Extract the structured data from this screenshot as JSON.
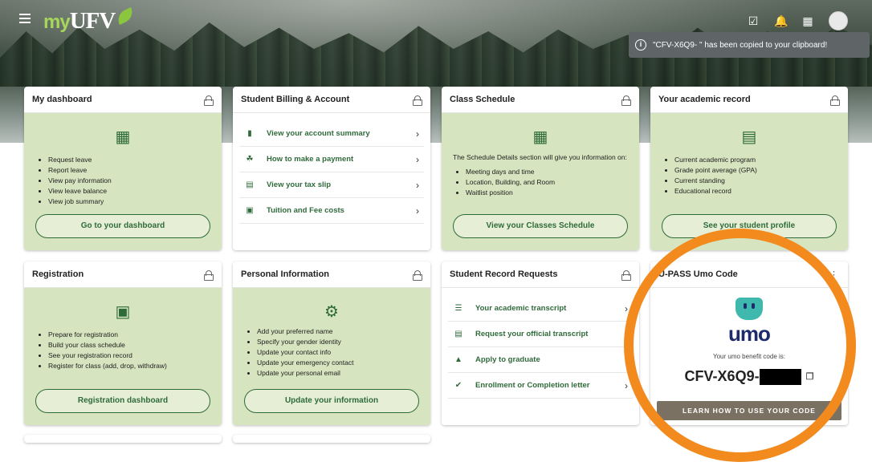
{
  "header": {
    "logo_prefix": "my",
    "logo_main": "UFV",
    "toast": "\"CFV-X6Q9-        \" has been copied to your clipboard!"
  },
  "cards": {
    "dashboard": {
      "title": "My dashboard",
      "items": [
        "Request leave",
        "Report leave",
        "View pay information",
        "View leave balance",
        "View job summary"
      ],
      "button": "Go to your dashboard"
    },
    "billing": {
      "title": "Student Billing & Account",
      "links": [
        "View your account summary",
        "How to make a payment",
        "View your tax slip",
        "Tuition and Fee costs"
      ]
    },
    "schedule": {
      "title": "Class Schedule",
      "intro": "The Schedule Details section will give you information on:",
      "items": [
        "Meeting days and time",
        "Location, Building, and Room",
        "Waitlist position"
      ],
      "button": "View your Classes Schedule"
    },
    "academic": {
      "title": "Your academic record",
      "items": [
        "Current academic program",
        "Grade point average (GPA)",
        "Current standing",
        "Educational record"
      ],
      "button": "See your student profile"
    },
    "registration": {
      "title": "Registration",
      "items": [
        "Prepare for registration",
        "Build your class schedule",
        "See your registration record",
        "Register for class (add, drop, withdraw)"
      ],
      "button": "Registration dashboard"
    },
    "personal": {
      "title": "Personal Information",
      "items": [
        "Add your preferred name",
        "Specify your gender identity",
        "Update your contact info",
        "Update your emergency contact",
        "Update your personal email"
      ],
      "button": "Update your information"
    },
    "records": {
      "title": "Student Record Requests",
      "links": [
        "Your academic transcript",
        "Request your official transcript",
        "Apply to graduate",
        "Enrollment or Completion letter"
      ]
    },
    "upass": {
      "title": "U-PASS Umo Code",
      "brand": "umo",
      "subtitle": "Your umo benefit code is:",
      "code": "CFV-X6Q9-",
      "button": "LEARN HOW TO USE YOUR CODE"
    }
  },
  "icons": {
    "menu": "menu-icon",
    "calendar_check": "calendar-check-icon",
    "bell": "bell-icon",
    "apps": "apps-grid-icon"
  },
  "colors": {
    "accent_green": "#2f6b3a",
    "card_green": "#d6e4bf",
    "highlight_ring": "#f28a1e",
    "umo_navy": "#1d2a6b",
    "umo_teal": "#3fb9ad"
  }
}
